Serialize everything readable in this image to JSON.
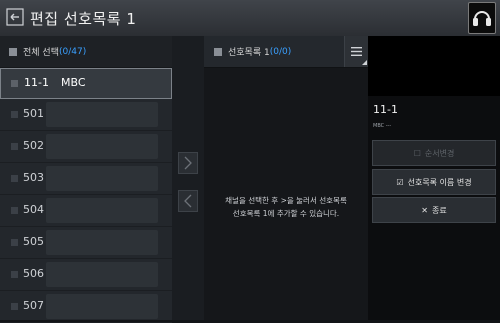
{
  "header": {
    "title": "편집 선호목록 1"
  },
  "left_panel": {
    "header_label": "전체 선택",
    "header_count": "(0/47)",
    "channels": [
      {
        "num": "11-1",
        "name": "MBC"
      },
      {
        "num": "501",
        "name": ""
      },
      {
        "num": "502",
        "name": ""
      },
      {
        "num": "503",
        "name": ""
      },
      {
        "num": "504",
        "name": ""
      },
      {
        "num": "505",
        "name": ""
      },
      {
        "num": "506",
        "name": ""
      },
      {
        "num": "507",
        "name": ""
      }
    ]
  },
  "favorites": {
    "header_label": "선호목록 1",
    "header_count": "(0/0)",
    "empty_line1": "채널을 선택한 후 >을 눌러서 선호목록",
    "empty_line2": "선호목록 1에 추가할 수 있습니다."
  },
  "info": {
    "channel_num": "11-1",
    "channel_name": "MBC ---",
    "btn_reorder": "순서변경",
    "btn_rename": "선호목록 이름 변경",
    "btn_close": "종료"
  },
  "colors": {
    "accent": "#3aa0ff",
    "panel_bg": "#23272c"
  }
}
